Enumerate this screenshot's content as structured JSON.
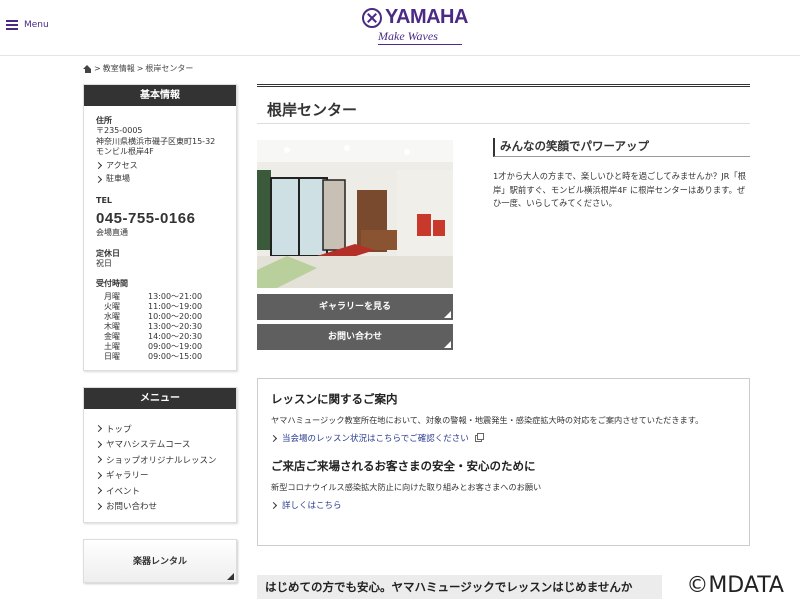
{
  "header": {
    "menu_label": "Menu",
    "logo_text": "YAMAHA",
    "logo_tagline": "Make Waves"
  },
  "breadcrumb": {
    "items": [
      "教室情報",
      "根岸センター"
    ],
    "separator": ">"
  },
  "sidebar": {
    "basic_info": {
      "title": "基本情報",
      "address_label": "住所",
      "postal": "〒235-0005",
      "address_line1": "神奈川県横浜市磯子区東町15-32",
      "address_line2": "モンビル根岸4F",
      "links": [
        "アクセス",
        "駐車場"
      ],
      "tel_label": "TEL",
      "tel": "045-755-0166",
      "tel_note": "会場直通",
      "closed_label": "定休日",
      "closed": "祝日",
      "hours_label": "受付時間",
      "hours": [
        {
          "day": "月曜",
          "time": "13:00～21:00"
        },
        {
          "day": "火曜",
          "time": "11:00～19:00"
        },
        {
          "day": "水曜",
          "time": "10:00～20:00"
        },
        {
          "day": "木曜",
          "time": "13:00～20:30"
        },
        {
          "day": "金曜",
          "time": "14:00～20:30"
        },
        {
          "day": "土曜",
          "time": "09:00～19:00"
        },
        {
          "day": "日曜",
          "time": "09:00～15:00"
        }
      ]
    },
    "menu": {
      "title": "メニュー",
      "items": [
        "トップ",
        "ヤマハシステムコース",
        "ショップオリジナルレッスン",
        "ギャラリー",
        "イベント",
        "お問い合わせ"
      ]
    },
    "rental": "楽器レンタル"
  },
  "main": {
    "title": "根岸センター",
    "gallery_button": "ギャラリーを見る",
    "contact_button": "お問い合わせ",
    "catch_title": "みんなの笑顔でパワーアップ",
    "catch_text": "1才から大人の方まで、楽しいひと時を過ごしてみませんか？JR「根岸」駅前すぐ、モンビル横浜根岸4F に根岸センターはあります。ぜひ一度、いらしてみてください。",
    "lesson_title": "レッスンに関するご案内",
    "lesson_text": "ヤマハミュージック教室所在地において、対象の警報・地震発生・感染症拡大時の対応をご案内させていただきます。",
    "lesson_link": "当会場のレッスン状況はこちらでご確認ください",
    "safety_title": "ご来店ご来場されるお客さまの安全・安心のために",
    "safety_text": "新型コロナウイルス感染拡大防止に向けた取り組みとお客さまへのお願い",
    "safety_link": "詳しくはこちら",
    "bottom_heading": "はじめての方でも安心。ヤマハミュージックでレッスンはじめませんか"
  },
  "watermark": "©MDATA",
  "colors": {
    "brand": "#4b2a86",
    "header_bar": "#333333",
    "button": "#5f5f5f",
    "link": "#2a3c8f"
  }
}
